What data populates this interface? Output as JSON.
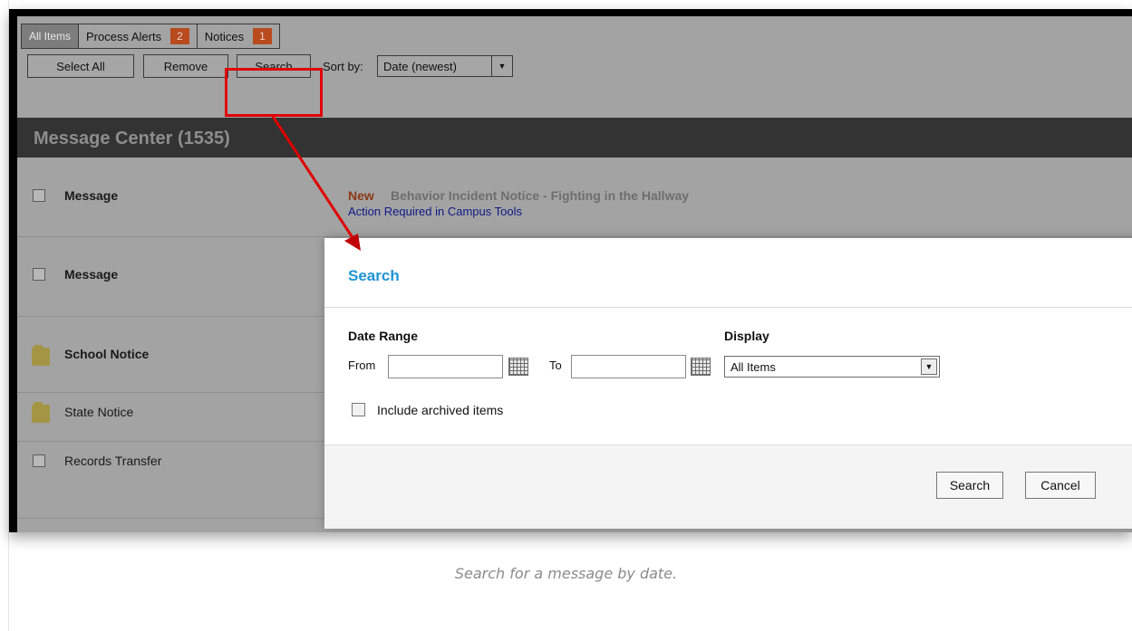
{
  "tabs": [
    {
      "label": "All Items"
    },
    {
      "label": "Process Alerts",
      "badge": "2"
    },
    {
      "label": "Notices",
      "badge": "1"
    }
  ],
  "toolbar": {
    "select_all": "Select All",
    "remove": "Remove",
    "search": "Search",
    "sort_label": "Sort by:",
    "sort_value": "Date (newest)"
  },
  "header": {
    "title": "Message Center (1535)"
  },
  "rows": [
    {
      "label": "Message",
      "new": "New",
      "subject": "Behavior Incident Notice - Fighting in the Hallway",
      "link": "Action Required in Campus Tools"
    },
    {
      "label": "Message"
    },
    {
      "label": "School Notice"
    },
    {
      "label": "State Notice"
    },
    {
      "label": "Records Transfer"
    }
  ],
  "dialog": {
    "title": "Search",
    "date_range_label": "Date Range",
    "from_label": "From",
    "to_label": "To",
    "from_value": "",
    "to_value": "",
    "display_label": "Display",
    "display_value": "All Items",
    "include_archived": "Include archived items",
    "search_button": "Search",
    "cancel_button": "Cancel"
  },
  "caption": "Search for a message by date.",
  "colors": {
    "annotation": "#e00000",
    "dialog_title": "#1f93d6",
    "badge": "#b84a1e"
  }
}
